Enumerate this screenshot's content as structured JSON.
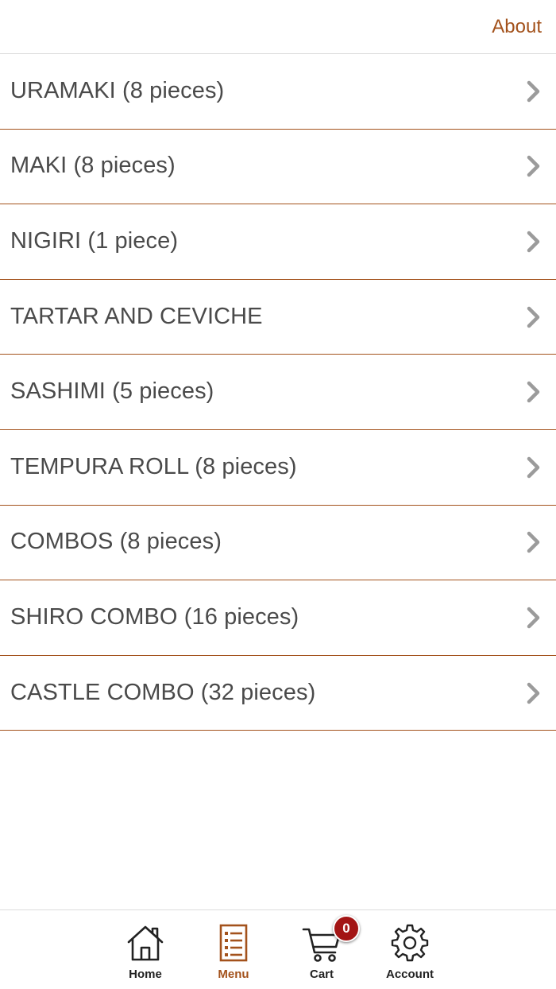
{
  "header": {
    "about_label": "About"
  },
  "menu": {
    "items": [
      {
        "label": "URAMAKI (8 pieces)"
      },
      {
        "label": "MAKI (8 pieces)"
      },
      {
        "label": "NIGIRI (1 piece)"
      },
      {
        "label": "TARTAR AND CEVICHE"
      },
      {
        "label": "SASHIMI (5 pieces)"
      },
      {
        "label": "TEMPURA ROLL (8 pieces)"
      },
      {
        "label": "COMBOS (8 pieces)"
      },
      {
        "label": "SHIRO COMBO (16 pieces)"
      },
      {
        "label": "CASTLE COMBO (32 pieces)"
      }
    ]
  },
  "tabbar": {
    "tabs": [
      {
        "label": "Home",
        "icon": "home-icon",
        "active": false
      },
      {
        "label": "Menu",
        "icon": "menu-list-icon",
        "active": true
      },
      {
        "label": "Cart",
        "icon": "cart-icon",
        "active": false,
        "badge": "0"
      },
      {
        "label": "Account",
        "icon": "gear-icon",
        "active": false
      }
    ]
  },
  "colors": {
    "accent": "#a3521c",
    "text": "#4a4a4a",
    "chevron": "#9b9b9b",
    "badge": "#a31515"
  }
}
